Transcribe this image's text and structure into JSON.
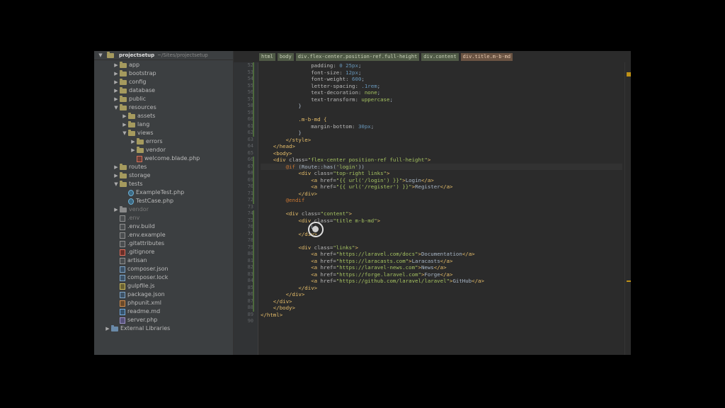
{
  "project": {
    "root_name": "projectsetup",
    "root_path": "~/Sites/projectsetup",
    "tree": [
      {
        "label": "app",
        "type": "folder",
        "depth": 0,
        "expand": "collapsed"
      },
      {
        "label": "bootstrap",
        "type": "folder",
        "depth": 0,
        "expand": "collapsed"
      },
      {
        "label": "config",
        "type": "folder",
        "depth": 0,
        "expand": "collapsed"
      },
      {
        "label": "database",
        "type": "folder",
        "depth": 0,
        "expand": "collapsed"
      },
      {
        "label": "public",
        "type": "folder",
        "depth": 0,
        "expand": "collapsed"
      },
      {
        "label": "resources",
        "type": "folder",
        "depth": 0,
        "expand": "expanded"
      },
      {
        "label": "assets",
        "type": "folder",
        "depth": 1,
        "expand": "collapsed"
      },
      {
        "label": "lang",
        "type": "folder",
        "depth": 1,
        "expand": "collapsed"
      },
      {
        "label": "views",
        "type": "folder",
        "depth": 1,
        "expand": "expanded"
      },
      {
        "label": "errors",
        "type": "folder",
        "depth": 2,
        "expand": "collapsed"
      },
      {
        "label": "vendor",
        "type": "folder",
        "depth": 2,
        "expand": "collapsed"
      },
      {
        "label": "welcome.blade.php",
        "type": "blade",
        "depth": 2,
        "expand": "none"
      },
      {
        "label": "routes",
        "type": "folder",
        "depth": 0,
        "expand": "collapsed"
      },
      {
        "label": "storage",
        "type": "folder",
        "depth": 0,
        "expand": "collapsed"
      },
      {
        "label": "tests",
        "type": "folder",
        "depth": 0,
        "expand": "expanded"
      },
      {
        "label": "ExampleTest.php",
        "type": "test",
        "depth": 1,
        "expand": "none"
      },
      {
        "label": "TestCase.php",
        "type": "test",
        "depth": 1,
        "expand": "none"
      },
      {
        "label": "vendor",
        "type": "folder-grey",
        "depth": 0,
        "expand": "collapsed",
        "muted": true
      },
      {
        "label": ".env",
        "type": "file",
        "depth": 0,
        "expand": "none",
        "muted": true
      },
      {
        "label": ".env.build",
        "type": "file",
        "depth": 0,
        "expand": "none"
      },
      {
        "label": ".env.example",
        "type": "file",
        "depth": 0,
        "expand": "none"
      },
      {
        "label": ".gitattributes",
        "type": "file",
        "depth": 0,
        "expand": "none"
      },
      {
        "label": ".gitignore",
        "type": "git",
        "depth": 0,
        "expand": "none"
      },
      {
        "label": "artisan",
        "type": "file",
        "depth": 0,
        "expand": "none"
      },
      {
        "label": "composer.json",
        "type": "json",
        "depth": 0,
        "expand": "none"
      },
      {
        "label": "composer.lock",
        "type": "json",
        "depth": 0,
        "expand": "none"
      },
      {
        "label": "gulpfile.js",
        "type": "js",
        "depth": 0,
        "expand": "none"
      },
      {
        "label": "package.json",
        "type": "json",
        "depth": 0,
        "expand": "none"
      },
      {
        "label": "phpunit.xml",
        "type": "xml",
        "depth": 0,
        "expand": "none"
      },
      {
        "label": "readme.md",
        "type": "md",
        "depth": 0,
        "expand": "none"
      },
      {
        "label": "server.php",
        "type": "php",
        "depth": 0,
        "expand": "none"
      },
      {
        "label": "External Libraries",
        "type": "lib",
        "depth": -1,
        "expand": "collapsed"
      }
    ]
  },
  "breadcrumb": [
    {
      "label": "html",
      "active": false
    },
    {
      "label": "body",
      "active": false
    },
    {
      "label": "div.flex-center.position-ref.full-height",
      "active": false
    },
    {
      "label": "div.content",
      "active": false
    },
    {
      "label": "div.title.m-b-md",
      "active": true
    }
  ],
  "editor": {
    "first_line_number": 52,
    "lines": [
      [
        [
          "                padding: ",
          "tok-prop"
        ],
        [
          "0 25px",
          "tok-num"
        ],
        [
          ";",
          "tok-plain"
        ]
      ],
      [
        [
          "                font-size: ",
          "tok-prop"
        ],
        [
          "12px",
          "tok-num"
        ],
        [
          ";",
          "tok-plain"
        ]
      ],
      [
        [
          "                font-weight: ",
          "tok-prop"
        ],
        [
          "600",
          "tok-num"
        ],
        [
          ";",
          "tok-plain"
        ]
      ],
      [
        [
          "                letter-spacing: ",
          "tok-prop"
        ],
        [
          ".1rem",
          "tok-num"
        ],
        [
          ";",
          "tok-plain"
        ]
      ],
      [
        [
          "                text-decoration: ",
          "tok-prop"
        ],
        [
          "none",
          "tok-str"
        ],
        [
          ";",
          "tok-plain"
        ]
      ],
      [
        [
          "                text-transform: ",
          "tok-prop"
        ],
        [
          "uppercase",
          "tok-str"
        ],
        [
          ";",
          "tok-plain"
        ]
      ],
      [
        [
          "            }",
          "tok-plain"
        ]
      ],
      [
        [
          "",
          "tok-plain"
        ]
      ],
      [
        [
          "            .m-b-md {",
          "tok-sel"
        ]
      ],
      [
        [
          "                margin-bottom: ",
          "tok-prop"
        ],
        [
          "30px",
          "tok-num"
        ],
        [
          ";",
          "tok-plain"
        ]
      ],
      [
        [
          "            }",
          "tok-plain"
        ]
      ],
      [
        [
          "        </style>",
          "tok-tag"
        ]
      ],
      [
        [
          "    </head>",
          "tok-tag"
        ]
      ],
      [
        [
          "    <body>",
          "tok-tag"
        ]
      ],
      [
        [
          "    <div ",
          "tok-tag"
        ],
        [
          "class=",
          "tok-attr"
        ],
        [
          "\"flex-center position-ref full-height\"",
          "tok-str"
        ],
        [
          ">",
          "tok-tag"
        ]
      ],
      [
        [
          "        @if ",
          "tok-kw"
        ],
        [
          "(Route::has(",
          "tok-plain"
        ],
        [
          "'login'",
          "tok-str"
        ],
        [
          "))",
          "tok-plain"
        ]
      ],
      [
        [
          "            <div ",
          "tok-tag"
        ],
        [
          "class=",
          "tok-attr"
        ],
        [
          "\"top-right links\"",
          "tok-str"
        ],
        [
          ">",
          "tok-tag"
        ]
      ],
      [
        [
          "                <a ",
          "tok-tag"
        ],
        [
          "href=",
          "tok-attr"
        ],
        [
          "\"{{ url(",
          "tok-str"
        ],
        [
          "'/login'",
          "tok-str"
        ],
        [
          ") }}\"",
          "tok-str"
        ],
        [
          ">",
          "tok-tag"
        ],
        [
          "Login",
          "tok-plain"
        ],
        [
          "</a>",
          "tok-tag"
        ]
      ],
      [
        [
          "                <a ",
          "tok-tag"
        ],
        [
          "href=",
          "tok-attr"
        ],
        [
          "\"{{ url(",
          "tok-str"
        ],
        [
          "'/register'",
          "tok-str"
        ],
        [
          ") }}\"",
          "tok-str"
        ],
        [
          ">",
          "tok-tag"
        ],
        [
          "Register",
          "tok-plain"
        ],
        [
          "</a>",
          "tok-tag"
        ]
      ],
      [
        [
          "            </div>",
          "tok-tag"
        ]
      ],
      [
        [
          "        @endif",
          "tok-kw"
        ]
      ],
      [
        [
          "",
          "tok-plain"
        ]
      ],
      [
        [
          "        <div ",
          "tok-tag"
        ],
        [
          "class=",
          "tok-attr"
        ],
        [
          "\"content\"",
          "tok-str"
        ],
        [
          ">",
          "tok-tag"
        ]
      ],
      [
        [
          "            <div ",
          "tok-tag"
        ],
        [
          "class=",
          "tok-attr"
        ],
        [
          "\"title m-b-md\"",
          "tok-str"
        ],
        [
          ">",
          "tok-tag"
        ]
      ],
      [
        [
          "                Li",
          "tok-plain"
        ]
      ],
      [
        [
          "            </div>",
          "tok-tag"
        ]
      ],
      [
        [
          "",
          "tok-plain"
        ]
      ],
      [
        [
          "            <div ",
          "tok-tag"
        ],
        [
          "class=",
          "tok-attr"
        ],
        [
          "\"links\"",
          "tok-str"
        ],
        [
          ">",
          "tok-tag"
        ]
      ],
      [
        [
          "                <a ",
          "tok-tag"
        ],
        [
          "href=",
          "tok-attr"
        ],
        [
          "\"https://laravel.com/docs\"",
          "tok-str"
        ],
        [
          ">",
          "tok-tag"
        ],
        [
          "Documentation",
          "tok-plain"
        ],
        [
          "</a>",
          "tok-tag"
        ]
      ],
      [
        [
          "                <a ",
          "tok-tag"
        ],
        [
          "href=",
          "tok-attr"
        ],
        [
          "\"https://laracasts.com\"",
          "tok-str"
        ],
        [
          ">",
          "tok-tag"
        ],
        [
          "Laracasts",
          "tok-plain"
        ],
        [
          "</a>",
          "tok-tag"
        ]
      ],
      [
        [
          "                <a ",
          "tok-tag"
        ],
        [
          "href=",
          "tok-attr"
        ],
        [
          "\"https://laravel-news.com\"",
          "tok-str"
        ],
        [
          ">",
          "tok-tag"
        ],
        [
          "News",
          "tok-plain"
        ],
        [
          "</a>",
          "tok-tag"
        ]
      ],
      [
        [
          "                <a ",
          "tok-tag"
        ],
        [
          "href=",
          "tok-attr"
        ],
        [
          "\"https://forge.laravel.com\"",
          "tok-str"
        ],
        [
          ">",
          "tok-tag"
        ],
        [
          "Forge",
          "tok-plain"
        ],
        [
          "</a>",
          "tok-tag"
        ]
      ],
      [
        [
          "                <a ",
          "tok-tag"
        ],
        [
          "href=",
          "tok-attr"
        ],
        [
          "\"https://github.com/laravel/laravel\"",
          "tok-str"
        ],
        [
          ">",
          "tok-tag"
        ],
        [
          "GitHub",
          "tok-plain"
        ],
        [
          "</a>",
          "tok-tag"
        ]
      ],
      [
        [
          "            </div>",
          "tok-tag"
        ]
      ],
      [
        [
          "        </div>",
          "tok-tag"
        ]
      ],
      [
        [
          "    </div>",
          "tok-tag"
        ]
      ],
      [
        [
          "    </body>",
          "tok-tag"
        ]
      ],
      [
        [
          "</html>",
          "tok-tag"
        ]
      ],
      [
        [
          "",
          "tok-plain"
        ]
      ]
    ],
    "highlighted_line": 15
  },
  "colors": {
    "folder": "#a59a5e",
    "tag": "#e8bf6a",
    "string": "#a5c261",
    "keyword": "#cc7832",
    "number": "#6897bb"
  }
}
